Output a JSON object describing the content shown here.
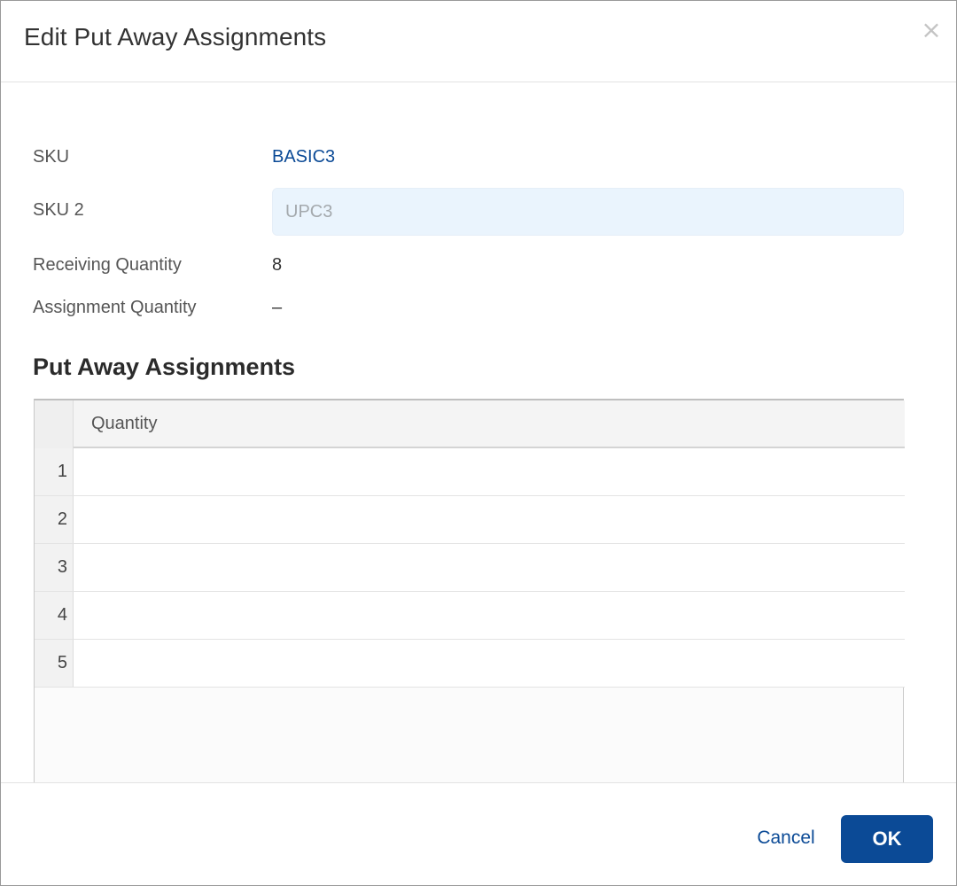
{
  "dialog": {
    "title": "Edit Put Away Assignments",
    "close_icon": "close-icon",
    "close_glyph": "×"
  },
  "fields": {
    "sku": {
      "label": "SKU",
      "value": "BASIC3"
    },
    "sku2": {
      "label": "SKU 2",
      "placeholder": "UPC3",
      "value": ""
    },
    "receiving_quantity": {
      "label": "Receiving Quantity",
      "value": "8"
    },
    "assignment_quantity": {
      "label": "Assignment Quantity",
      "value": "–"
    }
  },
  "section": {
    "title": "Put Away Assignments"
  },
  "grid": {
    "columns": [
      "Quantity"
    ],
    "rows": [
      {
        "num": "1",
        "quantity": ""
      },
      {
        "num": "2",
        "quantity": ""
      },
      {
        "num": "3",
        "quantity": ""
      },
      {
        "num": "4",
        "quantity": ""
      },
      {
        "num": "5",
        "quantity": ""
      }
    ]
  },
  "footer": {
    "cancel_label": "Cancel",
    "ok_label": "OK"
  },
  "colors": {
    "accent": "#0b4a96",
    "input_bg": "#eaf4fd",
    "grid_header_bg": "#f4f4f4"
  }
}
